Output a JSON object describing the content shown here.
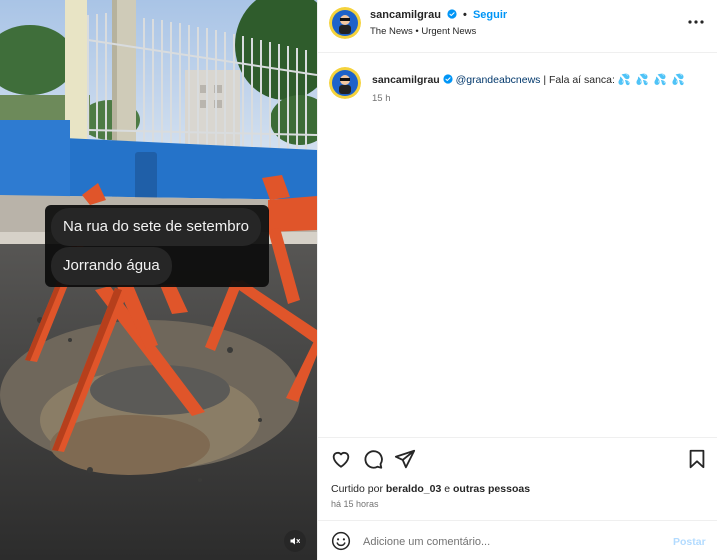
{
  "media": {
    "messages": [
      "Na rua do sete de setembro",
      "Jorrando água"
    ],
    "mute_icon": "speaker-muted-icon"
  },
  "post": {
    "username": "sancamilgrau",
    "follow_label": "Seguir",
    "dot": "•",
    "subtitle": "The News • Urgent News",
    "verified_color": "#0095f6"
  },
  "caption": {
    "username": "sancamilgrau",
    "mention": "@grandeabcnews",
    "text": " | Fala aí sanca: ",
    "emojis": "💦 💦 💦 💦",
    "time": "15 h"
  },
  "actions": {
    "icons": [
      "heart-icon",
      "comment-icon",
      "share-icon",
      "save-icon"
    ]
  },
  "likes": {
    "prefix": "Curtido por ",
    "user": "beraldo_03",
    "conj": " e ",
    "others": "outras pessoas"
  },
  "posted_time": "há 15 horas",
  "comment": {
    "placeholder": "Adicione um comentário...",
    "post_label": "Postar"
  },
  "colors": {
    "accent": "#0095f6",
    "link": "#00376b",
    "post_disabled": "#b3dbff"
  }
}
